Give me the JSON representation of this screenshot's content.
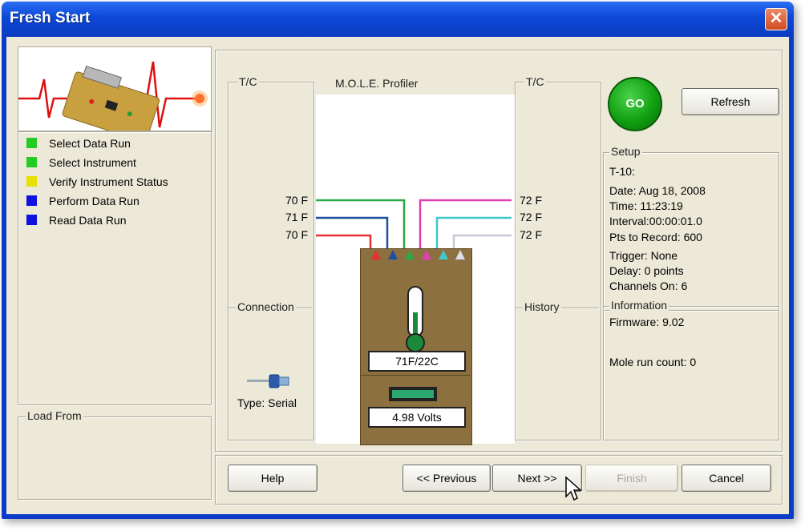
{
  "window": {
    "title": "Fresh Start",
    "close_glyph": "✕"
  },
  "steps": [
    {
      "label": "Select Data Run",
      "color": "#22cc22"
    },
    {
      "label": "Select Instrument",
      "color": "#22cc22"
    },
    {
      "label": "Verify Instrument Status",
      "color": "#e8e000"
    },
    {
      "label": "Perform Data Run",
      "color": "#1010e0"
    },
    {
      "label": "Read Data Run",
      "color": "#1010e0"
    }
  ],
  "load_from": {
    "label": "Load From"
  },
  "left_tc": {
    "label": "T/C",
    "temps": [
      "70 F",
      "71 F",
      "70 F"
    ]
  },
  "right_tc": {
    "label": "T/C",
    "temps": [
      "72 F",
      "72 F",
      "72 F"
    ]
  },
  "profiler": {
    "title": "M.O.L.E. Profiler",
    "temp_readout": "71F/22C",
    "volt_readout": "4.98 Volts"
  },
  "connection": {
    "label": "Connection",
    "type": "Type: Serial"
  },
  "history": {
    "label": "History"
  },
  "go_button": {
    "label": "GO"
  },
  "refresh_button": {
    "label": "Refresh"
  },
  "setup": {
    "label": "Setup",
    "lines": [
      "T-10:",
      "Date: Aug 18, 2008",
      "Time: 11:23:19",
      "Interval:00:00:01.0",
      "Pts to Record: 600",
      "Trigger: None",
      "Delay: 0 points",
      "Channels On: 6"
    ]
  },
  "information": {
    "label": "Information",
    "firmware": "Firmware: 9.02",
    "run_count": "Mole run count: 0"
  },
  "footer": {
    "help": "Help",
    "previous": "<< Previous",
    "next": "Next >>",
    "finish": "Finish",
    "cancel": "Cancel"
  },
  "colors": {
    "wire_left": [
      "#2aa84a",
      "#1e4fa0",
      "#e83030"
    ],
    "wire_right": [
      "#e040b0",
      "#40c8c8",
      "#c8c8d8"
    ],
    "device_body": "#8c7040",
    "go_green": "#11a011"
  },
  "icons": {
    "serial_connector": "serial-connector-icon",
    "cursor": "mouse-cursor-icon"
  }
}
